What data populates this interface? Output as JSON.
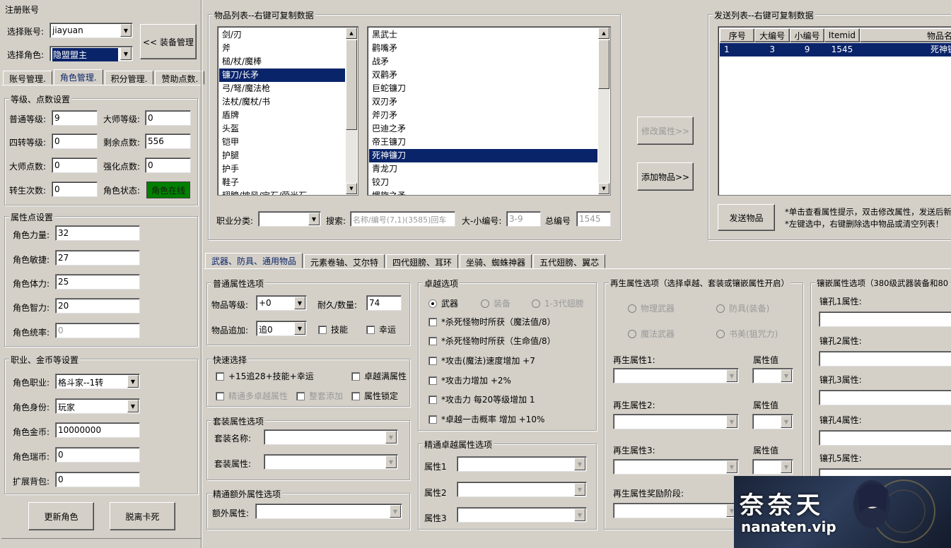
{
  "left": {
    "title": "注册账号",
    "account": {
      "label": "选择账号:",
      "value": "jiayuan"
    },
    "role": {
      "label": "选择角色:",
      "value": "隐盟盟主"
    },
    "equip_btn": "<< 装备管理",
    "tabs": [
      "账号管理.",
      "角色管理.",
      "积分管理.",
      "赞助点数."
    ],
    "level_group": {
      "title": "等级、点数设置",
      "fields": [
        {
          "label": "普通等级:",
          "value": "9"
        },
        {
          "label": "大师等级:",
          "value": "0"
        },
        {
          "label": "四转等级:",
          "value": "0"
        },
        {
          "label": "剩余点数:",
          "value": "556"
        },
        {
          "label": "大师点数:",
          "value": "0"
        },
        {
          "label": "强化点数:",
          "value": "0"
        },
        {
          "label": "转生次数:",
          "value": "0"
        }
      ],
      "status_label": "角色状态:",
      "status_value": "角色在线",
      "status_color": "#008000"
    },
    "attr_group": {
      "title": "属性点设置",
      "fields": [
        {
          "label": "角色力量:",
          "value": "32"
        },
        {
          "label": "角色敏捷:",
          "value": "27"
        },
        {
          "label": "角色体力:",
          "value": "25"
        },
        {
          "label": "角色智力:",
          "value": "20"
        },
        {
          "label": "角色统率:",
          "value": "0"
        }
      ]
    },
    "job_group": {
      "title": "职业、金币等设置",
      "job": {
        "label": "角色职业:",
        "value": "格斗家--1转"
      },
      "identity": {
        "label": "角色身份:",
        "value": "玩家"
      },
      "gold": {
        "label": "角色金币:",
        "value": "10000000"
      },
      "ruby": {
        "label": "角色瑞币:",
        "value": "0"
      },
      "bag": {
        "label": "扩展背包:",
        "value": "0"
      }
    },
    "update_btn": "更新角色",
    "unstuck_btn": "脱离卡死"
  },
  "items": {
    "title": "物品列表--右键可复制数据",
    "categories": [
      "剑/刃",
      "斧",
      "槌/杖/魔棒",
      "镰刀/长矛",
      "弓/弩/魔法枪",
      "法杖/魔杖/书",
      "盾牌",
      "头盔",
      "铠甲",
      "护腿",
      "护手",
      "鞋子",
      "翅膀/披风/宝石/萤光石"
    ],
    "selected_category": 3,
    "names": [
      "黑武士",
      "鹳嘴矛",
      "战矛",
      "双鹳矛",
      "巨蛇镰刀",
      "双刃矛",
      "斧刃矛",
      "巴迪之矛",
      "帝王镰刀",
      "死神镰刀",
      "青龙刀",
      "铰刀",
      "螺旋之矛"
    ],
    "selected_name": 9,
    "job_label": "职业分类:",
    "search_label": "搜索:",
    "search_placeholder": "名称/编号(7,1)(3585)回车",
    "size_label": "大-小编号:",
    "size_value": "3-9",
    "total_label": "总编号",
    "total_value": "1545"
  },
  "mid_buttons": {
    "modify": "修改属性>>",
    "add": "添加物品>>"
  },
  "send": {
    "title": "发送列表--右键可复制数据",
    "headers": [
      "序号",
      "大编号",
      "小编号",
      "Itemid",
      "物品名"
    ],
    "row": [
      "1",
      "3",
      "9",
      "1545",
      "死神镰"
    ],
    "send_btn": "发送物品",
    "hint1": "*单击查看属性提示，双击修改属性，发送后新",
    "hint2": "*左键选中，右键删除选中物品或清空列表！"
  },
  "btabs": [
    "武器、防具、通用物品",
    "元素卷轴、艾尔特",
    "四代翅膀、耳环",
    "坐骑、蜘蛛神器",
    "五代翅膀、翼芯"
  ],
  "normal": {
    "title": "普通属性选项",
    "level_label": "物品等级:",
    "level_value": "+0",
    "dur_label": "耐久/数量:",
    "dur_value": "74",
    "add_label": "物品追加:",
    "add_value": "追0",
    "skill": "技能",
    "luck": "幸运"
  },
  "quick": {
    "title": "快速选择",
    "c1": "+15追28+技能+幸运",
    "c2": "卓越满属性",
    "c3": "精通多卓越属性",
    "c4": "整套添加",
    "c5": "属性锁定"
  },
  "set": {
    "title": "套装属性选项",
    "name_label": "套装名称:",
    "attr_label": "套装属性:"
  },
  "extra": {
    "title": "精通额外属性选项",
    "label": "额外属性:"
  },
  "exc": {
    "title": "卓越选项",
    "r1": "武器",
    "r2": "装备",
    "r3": "1-3代翅膀",
    "opts": [
      "*杀死怪物时所获（魔法值/8）",
      "*杀死怪物时所获（生命值/8）",
      "*攻击(魔法)速度增加 +7",
      "*攻击力增加 +2%",
      "*攻击力 每20等级增加 1",
      "*卓越一击概率 增加 +10%"
    ]
  },
  "exc2": {
    "title": "精通卓越属性选项",
    "labels": [
      "属性1",
      "属性2",
      "属性3"
    ]
  },
  "regen": {
    "title": "再生属性选项（选择卓越、套装或镶嵌属性开启）",
    "r1": "物理武器",
    "r2": "防具(装备)",
    "r3": "魔法武器",
    "r4": "书美(狙咒力)",
    "labels": [
      "再生属性1:",
      "再生属性2:",
      "再生属性3:"
    ],
    "val_label": "属性值",
    "reward_label": "再生属性奖励阶段:"
  },
  "socket": {
    "title": "镶嵌属性选项（380级武器装备和80",
    "labels": [
      "镶孔1属性:",
      "镶孔2属性:",
      "镶孔3属性:",
      "镶孔4属性:",
      "镶孔5属性:"
    ]
  },
  "watermark": {
    "cn": "奈奈天",
    "url": "nanaten.vip"
  }
}
